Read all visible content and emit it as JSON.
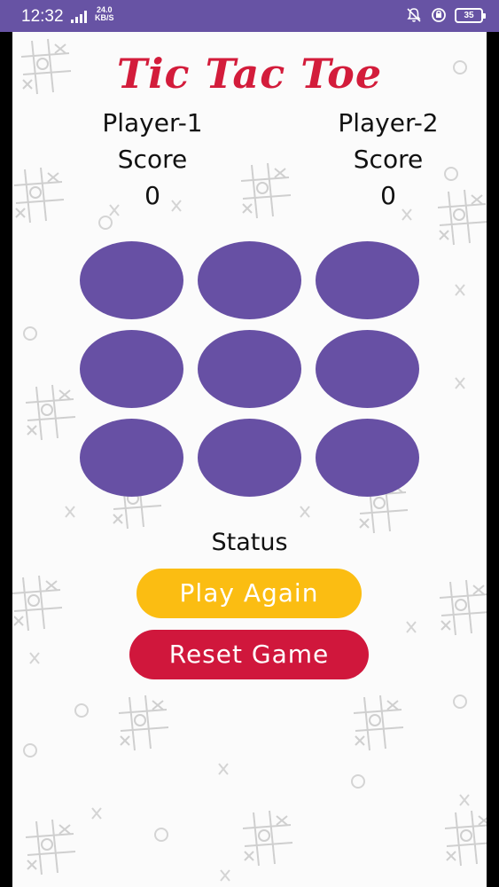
{
  "status_bar": {
    "time": "12:32",
    "net_speed_value": "24.0",
    "net_speed_unit": "KB/S",
    "battery": "35"
  },
  "app": {
    "title": "Tic Tac Toe",
    "player1": {
      "name": "Player-1",
      "score_label": "Score",
      "score": "0"
    },
    "player2": {
      "name": "Player-2",
      "score_label": "Score",
      "score": "0"
    },
    "board": [
      "",
      "",
      "",
      "",
      "",
      "",
      "",
      "",
      ""
    ],
    "status": "Status",
    "play_again_label": "Play Again",
    "reset_label": "Reset Game"
  },
  "colors": {
    "status_bar": "#6753a4",
    "cell": "#6750a4",
    "title": "#d31c3b",
    "play_again": "#fbbd12",
    "reset": "#d0173c"
  }
}
